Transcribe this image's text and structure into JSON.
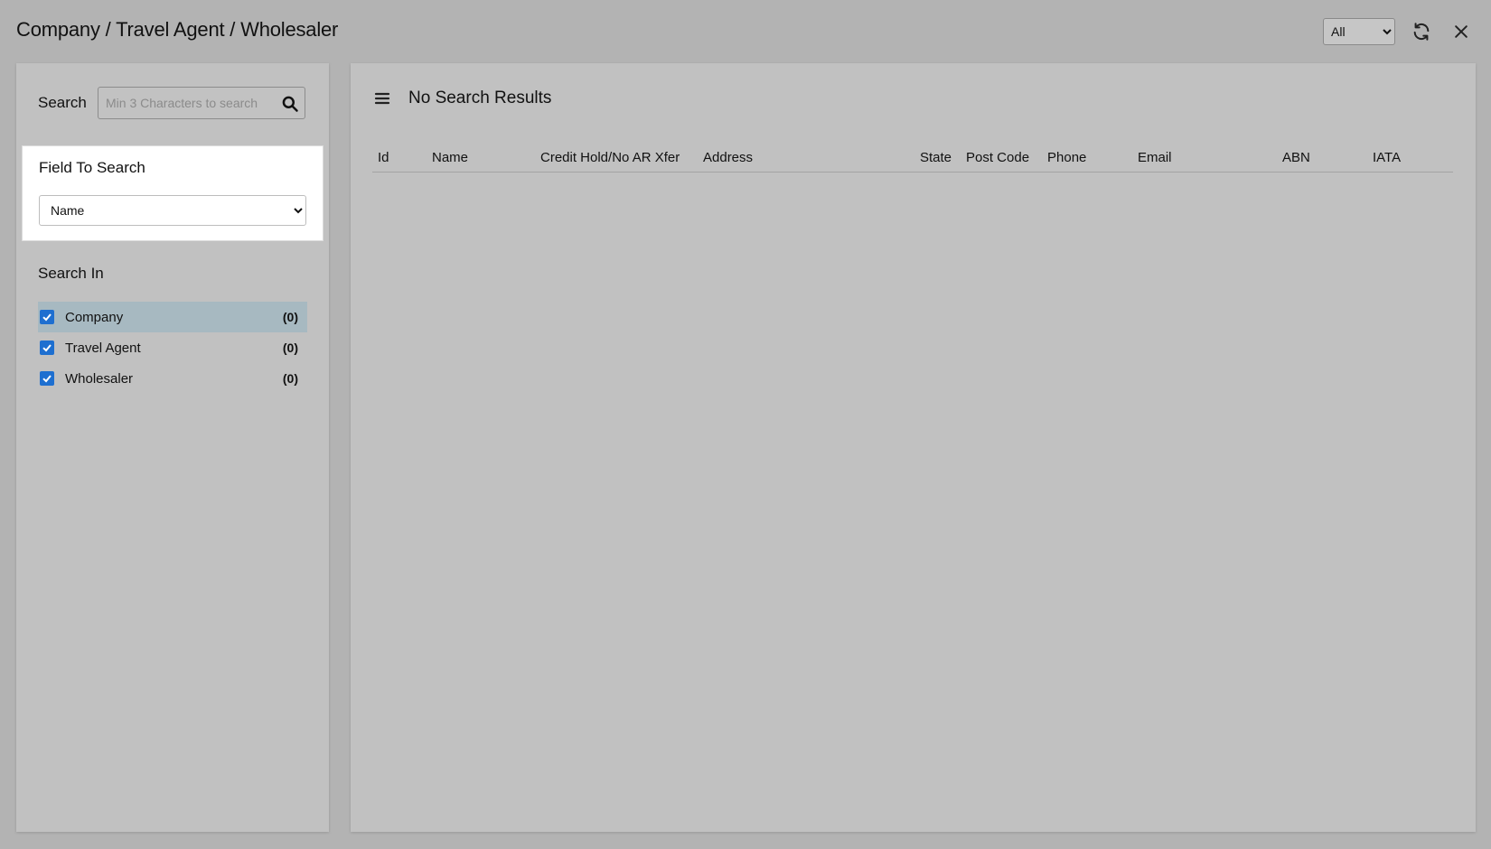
{
  "header": {
    "title": "Company / Travel Agent / Wholesaler",
    "scope_options": [
      "All"
    ],
    "scope_selected": "All",
    "refresh_icon": "refresh-icon",
    "close_icon": "close-icon"
  },
  "sidebar": {
    "search_label": "Search",
    "search_placeholder": "Min 3 Characters to search",
    "search_value": "",
    "search_icon": "search-icon",
    "field_card": {
      "title": "Field To Search",
      "selected": "Name",
      "options": [
        "Name"
      ]
    },
    "search_in_title": "Search In",
    "sources": [
      {
        "label": "Company",
        "count": "(0)",
        "checked": true,
        "highlighted": true
      },
      {
        "label": "Travel Agent",
        "count": "(0)",
        "checked": true,
        "highlighted": false
      },
      {
        "label": "Wholesaler",
        "count": "(0)",
        "checked": true,
        "highlighted": false
      }
    ]
  },
  "results": {
    "menu_icon": "hamburger-menu-icon",
    "title": "No Search Results",
    "columns": [
      "Id",
      "Name",
      "Credit Hold/No AR Xfer",
      "Address",
      "State",
      "Post Code",
      "Phone",
      "Email",
      "ABN",
      "IATA"
    ],
    "rows": []
  },
  "colors": {
    "background": "#b3b3b3",
    "panel": "#c1c1c1",
    "highlight_row": "#a7b9c1",
    "checkbox": "#1e6fd0"
  }
}
